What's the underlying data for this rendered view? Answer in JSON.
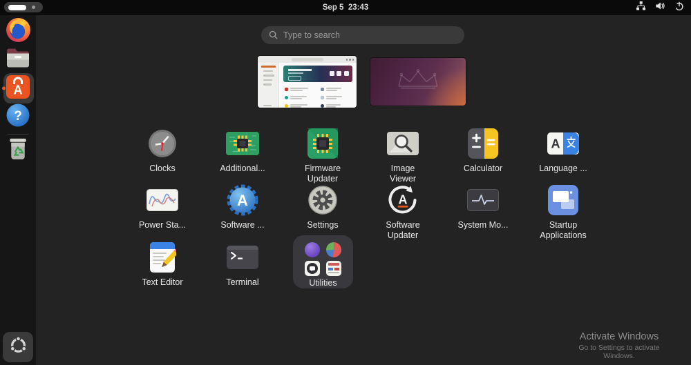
{
  "topbar": {
    "clock": "Sep 5  23:43",
    "workspace_indicator": {
      "active_workspace": 1,
      "workspace_count": 2
    },
    "status_icons": [
      "network-icon",
      "volume-icon",
      "power-icon"
    ]
  },
  "dock": {
    "items": [
      {
        "id": "firefox",
        "icon": "firefox-icon"
      },
      {
        "id": "files",
        "icon": "files-folder-icon"
      },
      {
        "id": "ubuntu-software",
        "icon": "ubuntu-software-icon",
        "running": true,
        "active": true
      },
      {
        "id": "help",
        "icon": "help-icon"
      },
      {
        "id": "trash",
        "icon": "trash-icon"
      }
    ],
    "show_apps_icon": "show-applications-icon"
  },
  "search": {
    "placeholder": "Type to search",
    "icon": "search-icon"
  },
  "workspaces": {
    "count": 2,
    "thumbnails": [
      {
        "name": "app-center-window"
      },
      {
        "name": "desktop-wallpaper"
      }
    ]
  },
  "apps": [
    {
      "label": "Clocks",
      "icon": "clocks-icon"
    },
    {
      "label": "Additional...",
      "icon": "additional-drivers-icon"
    },
    {
      "label": "Firmware\nUpdater",
      "icon": "firmware-updater-icon"
    },
    {
      "label": "Image\nViewer",
      "icon": "image-viewer-icon"
    },
    {
      "label": "Calculator",
      "icon": "calculator-icon"
    },
    {
      "label": "Language ...",
      "icon": "language-support-icon"
    },
    {
      "label": "Power Sta...",
      "icon": "power-statistics-icon"
    },
    {
      "label": "Software ...",
      "icon": "software-properties-icon"
    },
    {
      "label": "Settings",
      "icon": "settings-icon"
    },
    {
      "label": "Software\nUpdater",
      "icon": "software-updater-icon"
    },
    {
      "label": "System Mo...",
      "icon": "system-monitor-icon"
    },
    {
      "label": "Startup\nApplications",
      "icon": "startup-applications-icon"
    },
    {
      "label": "Text Editor",
      "icon": "text-editor-icon"
    },
    {
      "label": "Terminal",
      "icon": "terminal-icon"
    },
    {
      "label": "Utilities",
      "icon": "utilities-folder",
      "type": "folder",
      "mini_icons": [
        "purple-sphere-icon",
        "pie-chart-icon",
        "chat-bubble-icon",
        "document-icon"
      ]
    }
  ],
  "watermark": {
    "line1": "Activate Windows",
    "line2": "Go to Settings to activate Windows."
  },
  "colors": {
    "accent": "#e95420",
    "topbar_bg": "#0a0a0a",
    "dock_bg": "#161616",
    "overview_bg": "#232323",
    "search_bg": "#3a3a3a",
    "folder_bg": "#39393d"
  }
}
